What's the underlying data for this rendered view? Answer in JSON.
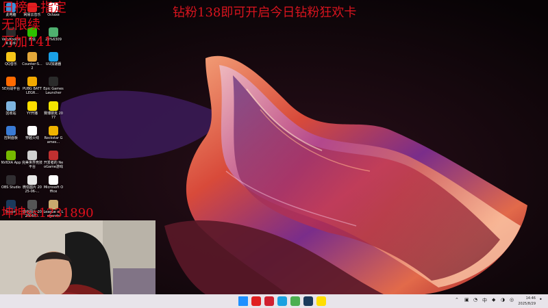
{
  "stream_banner": "钻粉138即可开启今日钻粉狂欢卡",
  "overlays": {
    "line1": "日榜一指定",
    "line2": "无限续",
    "line3": "万加141",
    "line4": "坤坤ss1231890"
  },
  "desktop_icons": [
    {
      "label": "此电脑",
      "icon": "computer-icon",
      "color": "#3a8fd8"
    },
    {
      "label": "网易云音乐",
      "icon": "netease-music-icon",
      "color": "#e02020"
    },
    {
      "label": "Octaxe",
      "icon": "app-icon",
      "color": "#ffffff"
    },
    {
      "label": "VeryKool VR 助手",
      "icon": "app-icon",
      "color": "#2b2b2b"
    },
    {
      "label": "微信",
      "icon": "wechat-icon",
      "color": "#2dc100"
    },
    {
      "label": "20%6309",
      "icon": "browser-icon",
      "color": "#4fb06f"
    },
    {
      "label": "QQ音乐",
      "icon": "qq-music-icon",
      "color": "#f5c518"
    },
    {
      "label": "Counter-S... 2",
      "icon": "cs2-icon",
      "color": "#e3a83a"
    },
    {
      "label": "UU加速器",
      "icon": "uu-icon",
      "color": "#1aa0e6"
    },
    {
      "label": "5E对战平台",
      "icon": "5e-icon",
      "color": "#ff6a00"
    },
    {
      "label": "PUBG BATTLEGR...",
      "icon": "pubg-icon",
      "color": "#f2a900"
    },
    {
      "label": "Epic Games Launcher",
      "icon": "epic-icon",
      "color": "#2a2a2a"
    },
    {
      "label": "回收站",
      "icon": "recycle-bin-icon",
      "color": "#7fb5e0"
    },
    {
      "label": "YY开播",
      "icon": "yy-icon",
      "color": "#ffde00"
    },
    {
      "label": "赛博朋克 2077",
      "icon": "cyberpunk-icon",
      "color": "#f3e600"
    },
    {
      "label": "控制面板",
      "icon": "control-panel-icon",
      "color": "#3a7bd5"
    },
    {
      "label": "穿越火线",
      "icon": "crossfire-icon",
      "color": "#ffffff"
    },
    {
      "label": "Rockstar Games...",
      "icon": "rockstar-icon",
      "color": "#f0b400"
    },
    {
      "label": "NVIDIA App",
      "icon": "nvidia-icon",
      "color": "#76b900"
    },
    {
      "label": "完美世界竞技平台",
      "icon": "perfect-world-icon",
      "color": "#d0d0d0"
    },
    {
      "label": "开发者的 NeoGame游戏",
      "icon": "app-icon",
      "color": "#c03030"
    },
    {
      "label": "OBS Studio",
      "icon": "obs-icon",
      "color": "#302e31"
    },
    {
      "label": "微信图片 2025-06-...",
      "icon": "image-file-icon",
      "color": "#e8e8e8"
    },
    {
      "label": "Microsoft Office",
      "icon": "document-icon",
      "color": "#ffffff"
    },
    {
      "label": "Steam",
      "icon": "steam-icon",
      "color": "#1b3a5b"
    },
    {
      "label": "微信图片 2025060...",
      "icon": "image-file-icon",
      "color": "#555555"
    },
    {
      "label": "League of Legends",
      "icon": "lol-icon",
      "color": "#c8aa6e"
    }
  ],
  "taskbar": {
    "apps": [
      {
        "icon": "windows-start-icon",
        "color": "#1e90ff"
      },
      {
        "icon": "netease-music-icon",
        "color": "#e02020"
      },
      {
        "icon": "app-icon",
        "color": "#d02030"
      },
      {
        "icon": "edge-icon",
        "color": "#1aa1e0"
      },
      {
        "icon": "chrome-icon",
        "color": "#4caf50"
      },
      {
        "icon": "steam-icon",
        "color": "#1b3a5b"
      },
      {
        "icon": "yy-icon",
        "color": "#ffde00"
      }
    ],
    "ime": "中",
    "time": "14:46",
    "date": "2025/8/29"
  }
}
